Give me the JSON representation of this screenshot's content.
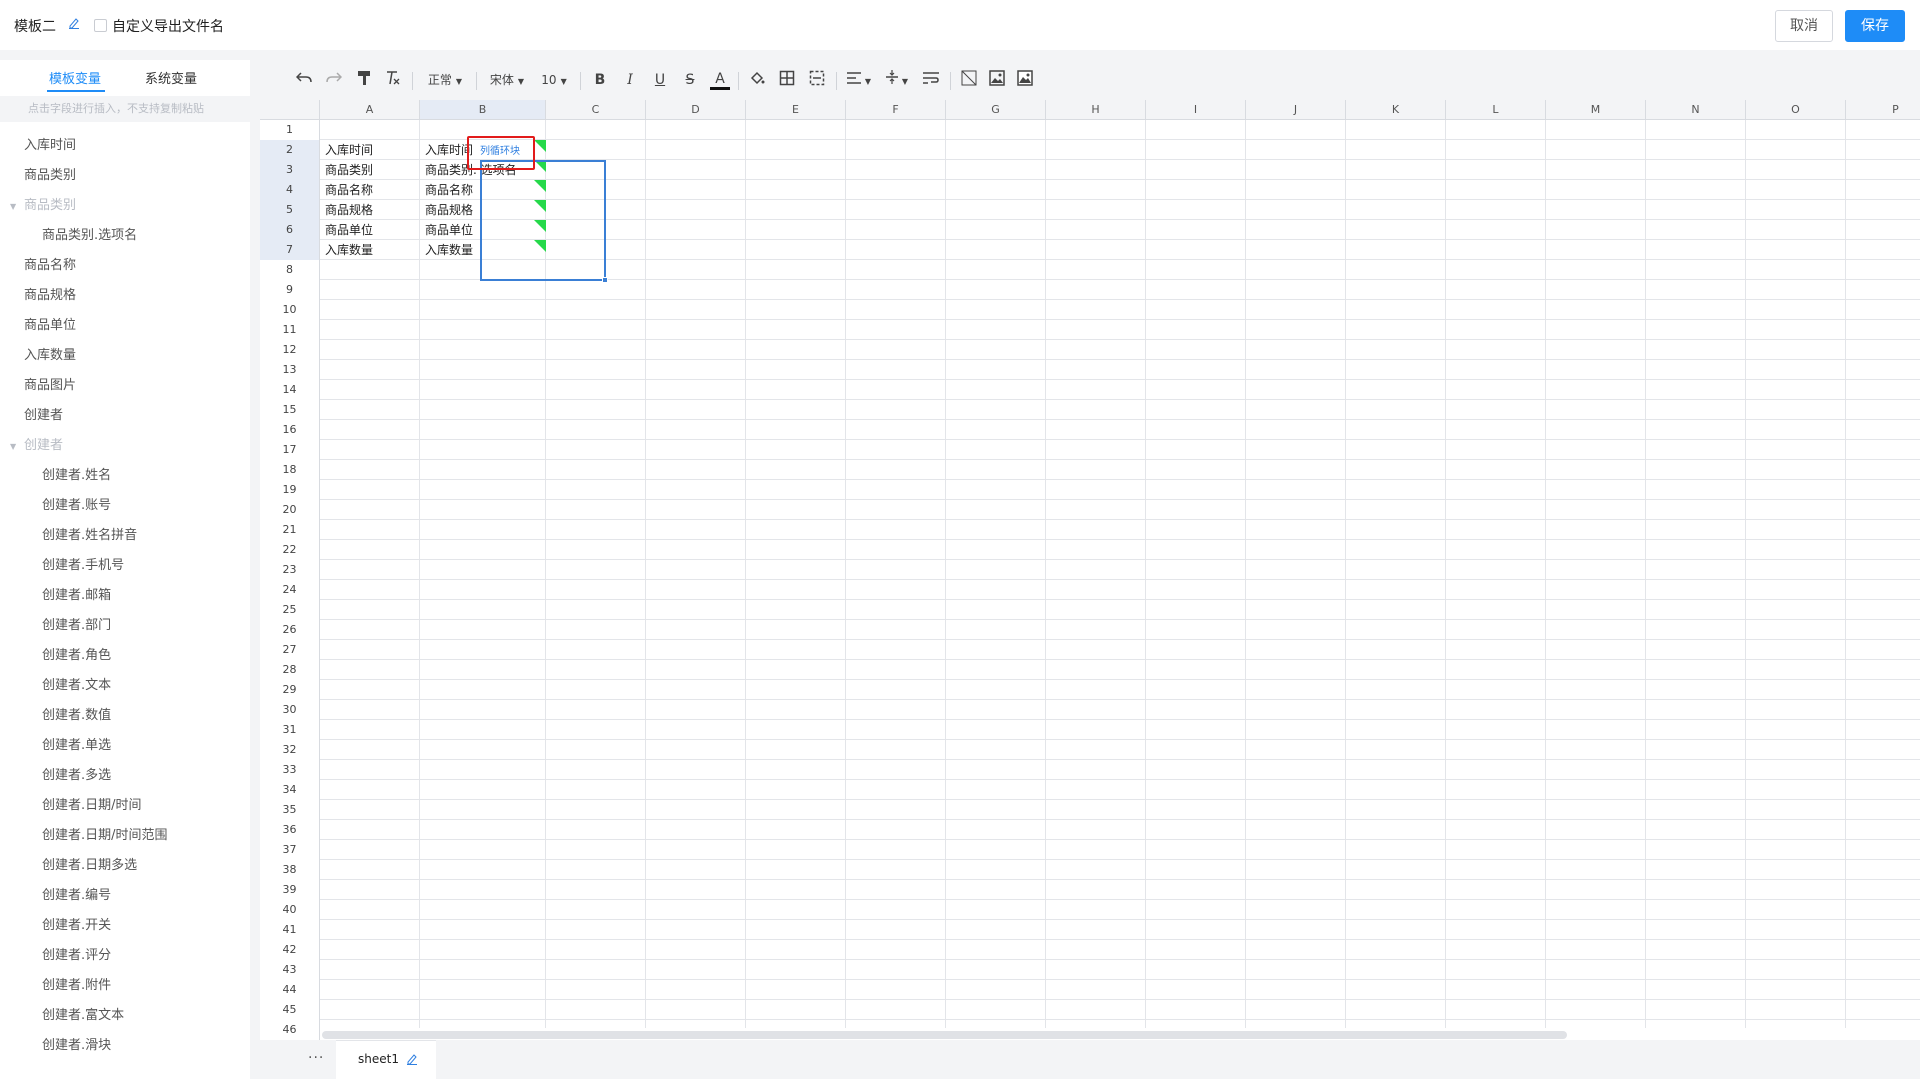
{
  "header": {
    "template_name": "模板二",
    "edit_icon": "pencil-icon",
    "custom_export_label": "自定义导出文件名",
    "cancel_label": "取消",
    "save_label": "保存"
  },
  "sidebar": {
    "tabs": [
      {
        "label": "模板变量",
        "active": true
      },
      {
        "label": "系统变量",
        "active": false
      }
    ],
    "hint": "点击字段进行插入，不支持复制粘贴",
    "items": [
      {
        "label": "入库时间",
        "kind": "item"
      },
      {
        "label": "商品类别",
        "kind": "item"
      },
      {
        "label": "商品类别",
        "kind": "group"
      },
      {
        "label": "商品类别.选项名",
        "kind": "child"
      },
      {
        "label": "商品名称",
        "kind": "item"
      },
      {
        "label": "商品规格",
        "kind": "item"
      },
      {
        "label": "商品单位",
        "kind": "item"
      },
      {
        "label": "入库数量",
        "kind": "item"
      },
      {
        "label": "商品图片",
        "kind": "item"
      },
      {
        "label": "创建者",
        "kind": "item"
      },
      {
        "label": "创建者",
        "kind": "group"
      },
      {
        "label": "创建者.姓名",
        "kind": "child"
      },
      {
        "label": "创建者.账号",
        "kind": "child"
      },
      {
        "label": "创建者.姓名拼音",
        "kind": "child"
      },
      {
        "label": "创建者.手机号",
        "kind": "child"
      },
      {
        "label": "创建者.邮箱",
        "kind": "child"
      },
      {
        "label": "创建者.部门",
        "kind": "child"
      },
      {
        "label": "创建者.角色",
        "kind": "child"
      },
      {
        "label": "创建者.文本",
        "kind": "child"
      },
      {
        "label": "创建者.数值",
        "kind": "child"
      },
      {
        "label": "创建者.单选",
        "kind": "child"
      },
      {
        "label": "创建者.多选",
        "kind": "child"
      },
      {
        "label": "创建者.日期/时间",
        "kind": "child"
      },
      {
        "label": "创建者.日期/时间范围",
        "kind": "child"
      },
      {
        "label": "创建者.日期多选",
        "kind": "child"
      },
      {
        "label": "创建者.编号",
        "kind": "child"
      },
      {
        "label": "创建者.开关",
        "kind": "child"
      },
      {
        "label": "创建者.评分",
        "kind": "child"
      },
      {
        "label": "创建者.附件",
        "kind": "child"
      },
      {
        "label": "创建者.富文本",
        "kind": "child"
      },
      {
        "label": "创建者.滑块",
        "kind": "child"
      }
    ]
  },
  "toolbar": {
    "undo_icon": "undo-icon",
    "redo_icon": "redo-icon",
    "format_painter_icon": "format-painter-icon",
    "clear_format_icon": "clear-format-icon",
    "style_value": "正常",
    "font_value": "宋体",
    "font_size_value": "10",
    "bold": "B",
    "italic": "I",
    "underline": "U",
    "strike": "S",
    "font_color": "A"
  },
  "spreadsheet": {
    "columns": [
      "A",
      "B",
      "C",
      "D",
      "E",
      "F",
      "G",
      "H",
      "I",
      "J",
      "K",
      "L",
      "M",
      "N",
      "O",
      "P"
    ],
    "row_count": 46,
    "selected_column": "B",
    "selected_rows": [
      2,
      3,
      4,
      5,
      6,
      7
    ],
    "loop_block_label": "列循环块",
    "cells_a": [
      "入库时间",
      "商品类别",
      "商品名称",
      "商品规格",
      "商品单位",
      "入库数量"
    ],
    "cells_b": [
      "入库时间",
      "商品类别. 选项名",
      "商品名称",
      "商品规格",
      "商品单位",
      "入库数量"
    ]
  },
  "bottom": {
    "more_label": "···",
    "sheet_name": "sheet1"
  },
  "colors": {
    "accent": "#1e8cf7",
    "selection": "#3a7fd5",
    "variable_marker": "#25d94a",
    "loop_frame": "#e21b1b"
  }
}
